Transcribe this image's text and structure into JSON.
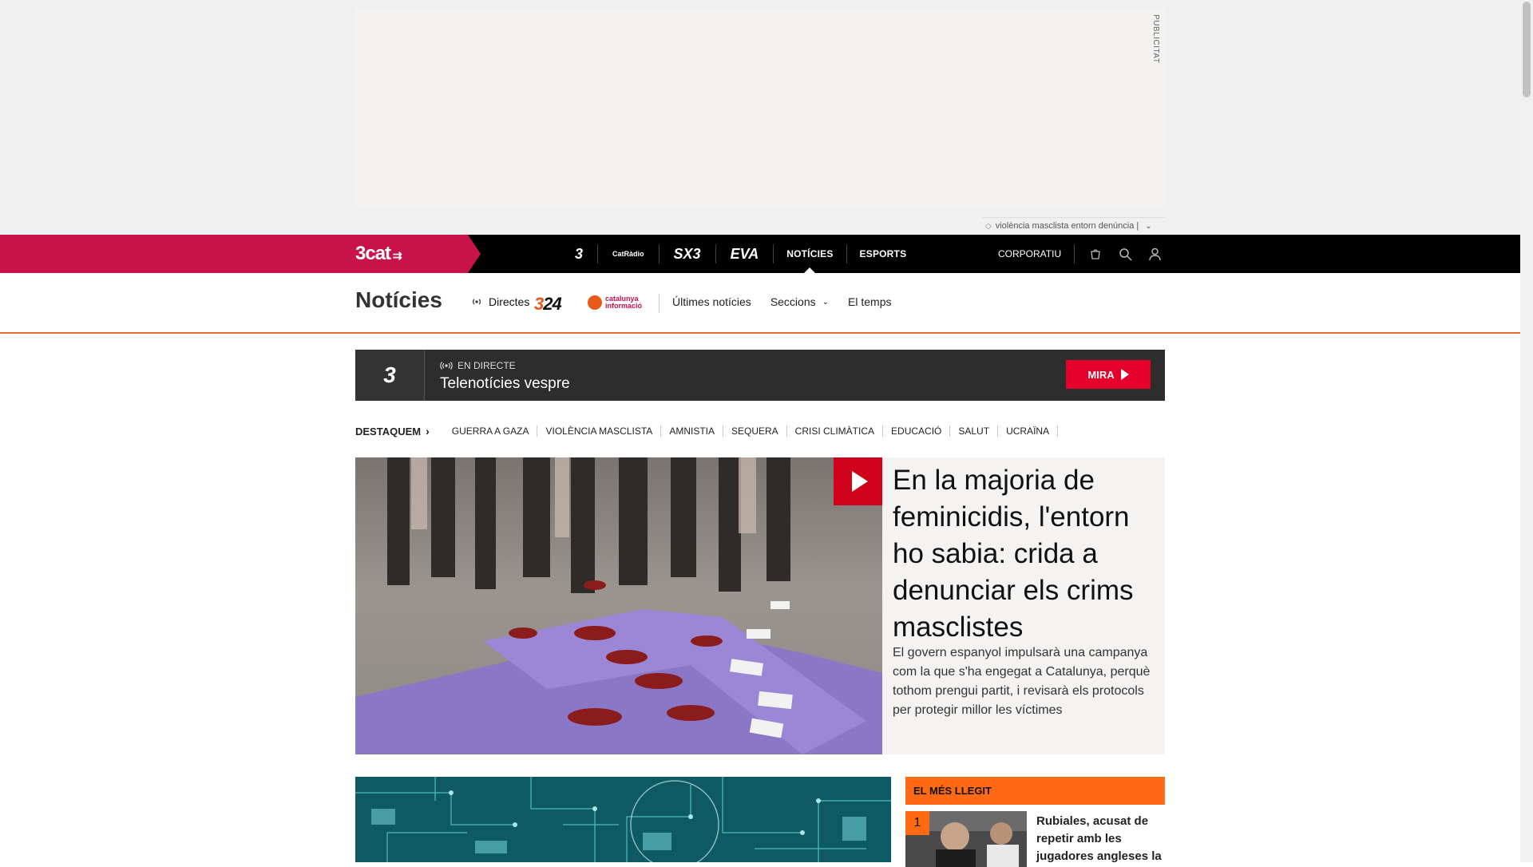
{
  "ad": {
    "label": "PUBLICITAT"
  },
  "tagline": {
    "text": "violència masclista entorn denúncia |"
  },
  "topnav": {
    "brand": "3cat",
    "channels": [
      "3",
      "CatRàdio",
      "SX3",
      "EVA"
    ],
    "links": [
      {
        "label": "NOTÍCIES",
        "active": true
      },
      {
        "label": "ESPORTS",
        "active": false
      }
    ],
    "corporate": "CORPORATIU",
    "icons": [
      "shop-icon",
      "search-icon",
      "user-icon"
    ]
  },
  "subnav": {
    "title": "Notícies",
    "live_label": "Directes",
    "logo_324": {
      "prefix": "3",
      "suffix": "24"
    },
    "logo_ci": {
      "line1": "catalunya",
      "line2": "informació"
    },
    "links": [
      "Últimes notícies",
      "Seccions",
      "El temps"
    ]
  },
  "live": {
    "channel_logo": "3",
    "tag": "EN DIRECTE",
    "title": "Telenotícies vespre",
    "button": "MIRA"
  },
  "highlights": {
    "heading": "DESTAQUEM",
    "items": [
      "GUERRA A GAZA",
      "VIOLÈNCIA MASCLISTA",
      "AMNISTIA",
      "SEQUERA",
      "CRISI CLIMÀTICA",
      "EDUCACIÓ",
      "SALUT",
      "UCRAÏNA"
    ]
  },
  "hero": {
    "title": "En la majoria de feminicidis, l'entorn ho sabia: crida a denunciar els crims masclistes",
    "summary": "El govern espanyol impulsarà una campanya com la que s'ha engegat a Catalunya, perquè tothom prengui partit, i revisarà els protocols per protegir millor les víctimes"
  },
  "most_read": {
    "heading": "EL MÉS LLEGIT",
    "items": [
      {
        "rank": "1",
        "title": "Rubiales, acusat de repetir amb les jugadores angleses la"
      }
    ]
  },
  "colors": {
    "brand": "#c8124a",
    "accent_orange": "#ff6a13",
    "live_red": "#e4002b",
    "hero_play": "#d0021b"
  }
}
